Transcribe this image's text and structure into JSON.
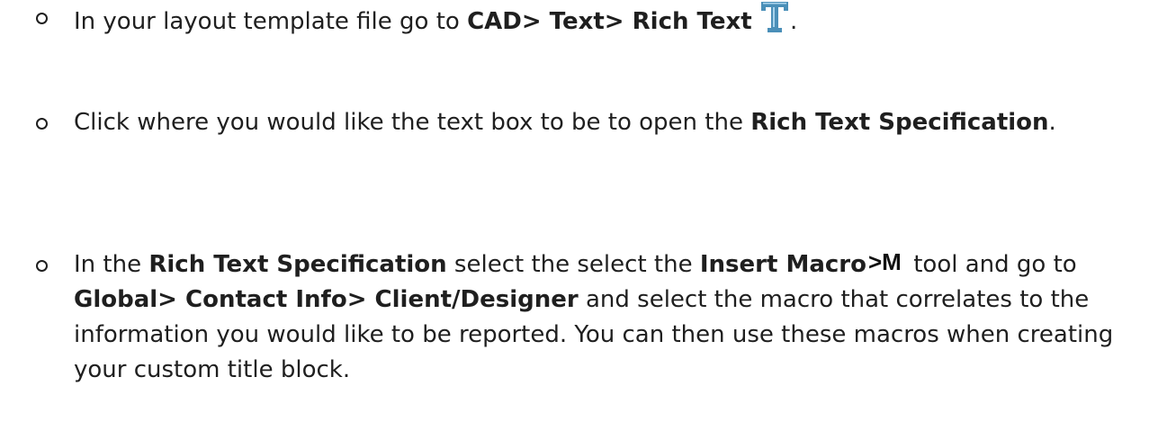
{
  "steps": [
    {
      "pre": "In your layout template file go to ",
      "path": "CAD> Text> Rich Text",
      "post": "."
    },
    {
      "pre": "Click where you would like the text box to be to open the ",
      "dialog": "Rich Text Specification",
      "post": "."
    },
    {
      "pre": "In the ",
      "dialog": "Rich Text Specification",
      "mid1": " select the select the ",
      "tool": "Insert Macro",
      "tool_icon_text": ">M",
      "mid2": " tool and go to ",
      "path": "Global> Contact Info> Client/Designer",
      "post": " and select the macro that correlates to the information you would like to be reported. You can then use these macros when creating your custom title block."
    }
  ],
  "icons": {
    "rich_text": "rich-text-t-icon",
    "insert_macro": "insert-macro-icon"
  },
  "colors": {
    "text": "#1f1f1f",
    "rich_text_icon": "#4a8fb8"
  }
}
